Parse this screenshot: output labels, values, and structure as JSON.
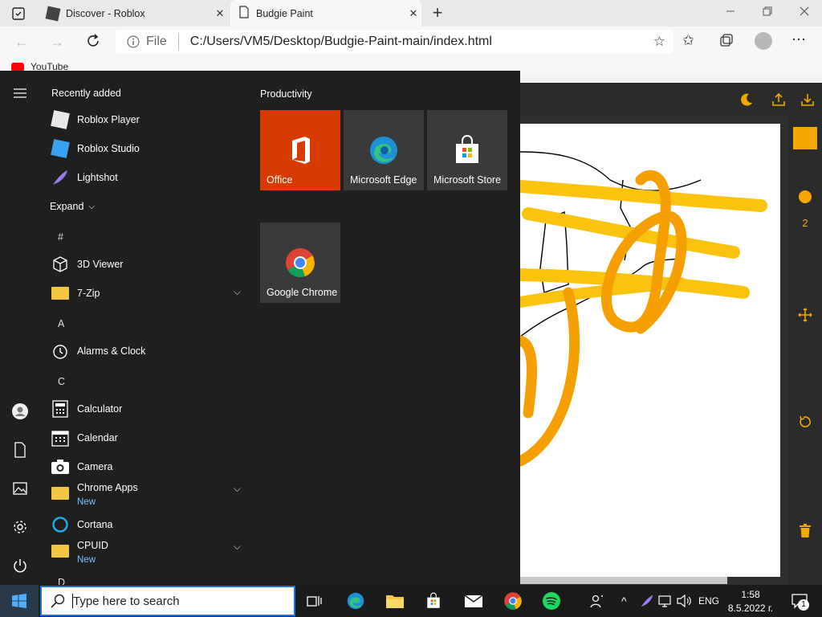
{
  "browser": {
    "tabs": [
      {
        "title": "Discover - Roblox"
      },
      {
        "title": "Budgie Paint"
      }
    ],
    "address": {
      "scheme_label": "File",
      "url": "C:/Users/VM5/Desktop/Budgie-Paint-main/index.html"
    },
    "bookmarks": [
      {
        "label": "YouTube"
      }
    ]
  },
  "paint": {
    "brush_size": "2",
    "accent_color": "#f5a700"
  },
  "start_menu": {
    "recently_added_title": "Recently added",
    "recent": [
      {
        "label": "Roblox Player"
      },
      {
        "label": "Roblox Studio"
      },
      {
        "label": "Lightshot"
      }
    ],
    "expand_label": "Expand",
    "groups": [
      {
        "letter": "#"
      },
      {
        "letter": "A"
      },
      {
        "letter": "C"
      },
      {
        "letter": "D"
      }
    ],
    "apps": [
      {
        "label": "3D Viewer"
      },
      {
        "label": "7-Zip"
      },
      {
        "label": "Alarms & Clock"
      },
      {
        "label": "Calculator"
      },
      {
        "label": "Calendar"
      },
      {
        "label": "Camera"
      },
      {
        "label": "Chrome Apps",
        "sub": "New"
      },
      {
        "label": "Cortana"
      },
      {
        "label": "CPUID",
        "sub": "New"
      }
    ],
    "productivity_title": "Productivity",
    "tiles": [
      {
        "label": "Office"
      },
      {
        "label": "Microsoft Edge"
      },
      {
        "label": "Microsoft Store"
      },
      {
        "label": "Google Chrome"
      }
    ]
  },
  "taskbar": {
    "search_placeholder": "Type here to search",
    "language": "ENG",
    "time": "1:58",
    "date": "8.5.2022 г.",
    "notification_count": "1"
  }
}
